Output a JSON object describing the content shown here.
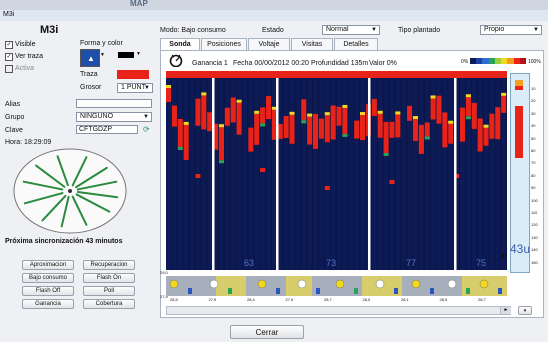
{
  "window": {
    "title": "M3i",
    "bg_text": "MAP"
  },
  "sidebar": {
    "title": "M3i",
    "visible_label": "Visible",
    "ver_traza_label": "Ver traza",
    "activa_label": "Activa",
    "forma_color_label": "Forma y color",
    "traza_label": "Traza",
    "grosor_label": "Grosor",
    "grosor_value": "1 PUNT",
    "alias_label": "Alias",
    "alias_value": "",
    "grupo_label": "Grupo",
    "grupo_value": "NINGUNO",
    "clave_label": "Clave",
    "clave_value": "CFTGDZP",
    "hora_label": "Hora: 18:29:09",
    "sync_label": "Próxima sincronización 43 minutos",
    "buttons": [
      "Aproximacion",
      "Recuperacion",
      "Bajo consumo",
      "Flash On",
      "Flash Off",
      "Poll",
      "Ganancia",
      "Cobertura"
    ]
  },
  "header": {
    "modo_label": "Modo: Bajo consumo",
    "estado_label": "Estado",
    "estado_value": "Normal",
    "tipo_label": "Tipo plantado",
    "tipo_value": "Propio"
  },
  "tabs": [
    {
      "label": "Sonda",
      "active": true
    },
    {
      "label": "Posiciones",
      "active": false
    },
    {
      "label": "Voltaje",
      "active": false
    },
    {
      "label": "Visitas",
      "active": false
    },
    {
      "label": "Detalles",
      "active": false
    }
  ],
  "sonar": {
    "ganancia": "Ganancia 1",
    "fecha": "Fecha 00/00/2012 00:20",
    "profundidad": "Profundidad 135m",
    "valor": "Valor 0%",
    "scale_min": "0%",
    "scale_max": "100%",
    "overlay_numbers": [
      "63",
      "73",
      "77",
      "75"
    ],
    "depth_ticks": [
      "10",
      "20",
      "30",
      "40",
      "50",
      "60",
      "70",
      "80",
      "90",
      "100",
      "110",
      "120",
      "130",
      "140",
      "150"
    ],
    "depth_value": "43u",
    "bottom_top_label": "29,0",
    "bottom_low_label": "27,9",
    "bottom_labels": [
      "28,5",
      "27,9",
      "28,4",
      "27,9",
      "28,7",
      "28,0",
      "28,1",
      "28,5",
      "28,7"
    ],
    "colors": {
      "bg": "#0c1a55",
      "hot": "#e8231a",
      "warm": "#f3d820",
      "cool": "#29a35a"
    }
  },
  "footer": {
    "close_label": "Cerrar"
  }
}
